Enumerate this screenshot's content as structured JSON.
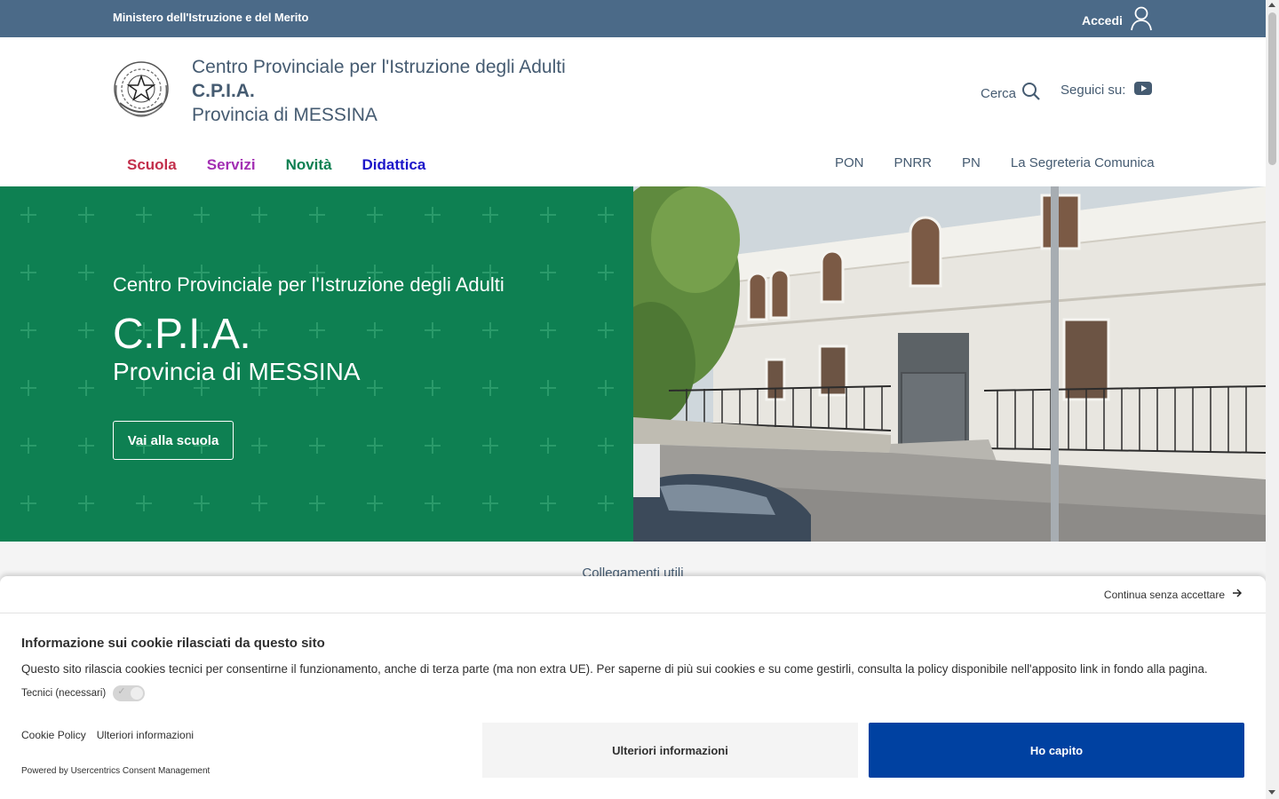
{
  "topbar": {
    "ministry": "Ministero dell'Istruzione e del Merito",
    "login_label": "Accedi"
  },
  "header": {
    "title_line1": "Centro Provinciale per l'Istruzione degli Adulti",
    "title_line2": "C.P.I.A.",
    "title_line3": "Provincia di MESSINA",
    "search_label": "Cerca",
    "follow_label": "Seguici su:",
    "social_icon": "youtube-icon"
  },
  "nav": {
    "main": [
      {
        "label": "Scuola",
        "color": "#c22f4b"
      },
      {
        "label": "Servizi",
        "color": "#a32fb3"
      },
      {
        "label": "Novità",
        "color": "#0e8052"
      },
      {
        "label": "Didattica",
        "color": "#1c16c9"
      }
    ],
    "secondary": [
      "PON",
      "PNRR",
      "PN",
      "La Segreteria Comunica"
    ]
  },
  "hero": {
    "subtitle": "Centro Provinciale per l'Istruzione degli Adulti",
    "title": "C.P.I.A.",
    "province": "Provincia di MESSINA",
    "button_label": "Vai alla scuola",
    "bg_color": "#0e8052"
  },
  "links_band": {
    "label": "Collegamenti utili"
  },
  "cookie": {
    "continue_label": "Continua senza accettare",
    "title": "Informazione sui cookie rilasciati da questo sito",
    "text": "Questo sito rilascia cookies tecnici per consentirne il funzionamento, anche di terza parte (ma non extra UE). Per saperne di più sui cookies e su come gestirli, consulta la policy disponibile nell'apposito link in fondo alla pagina.",
    "tech_label": "Tecnici (necessari)",
    "tech_enabled": true,
    "policy_link": "Cookie Policy",
    "more_link": "Ulteriori informazioni",
    "powered": "Powered by Usercentrics Consent Management",
    "btn_more": "Ulteriori informazioni",
    "btn_ok": "Ho capito",
    "accent": "#0041a1"
  }
}
